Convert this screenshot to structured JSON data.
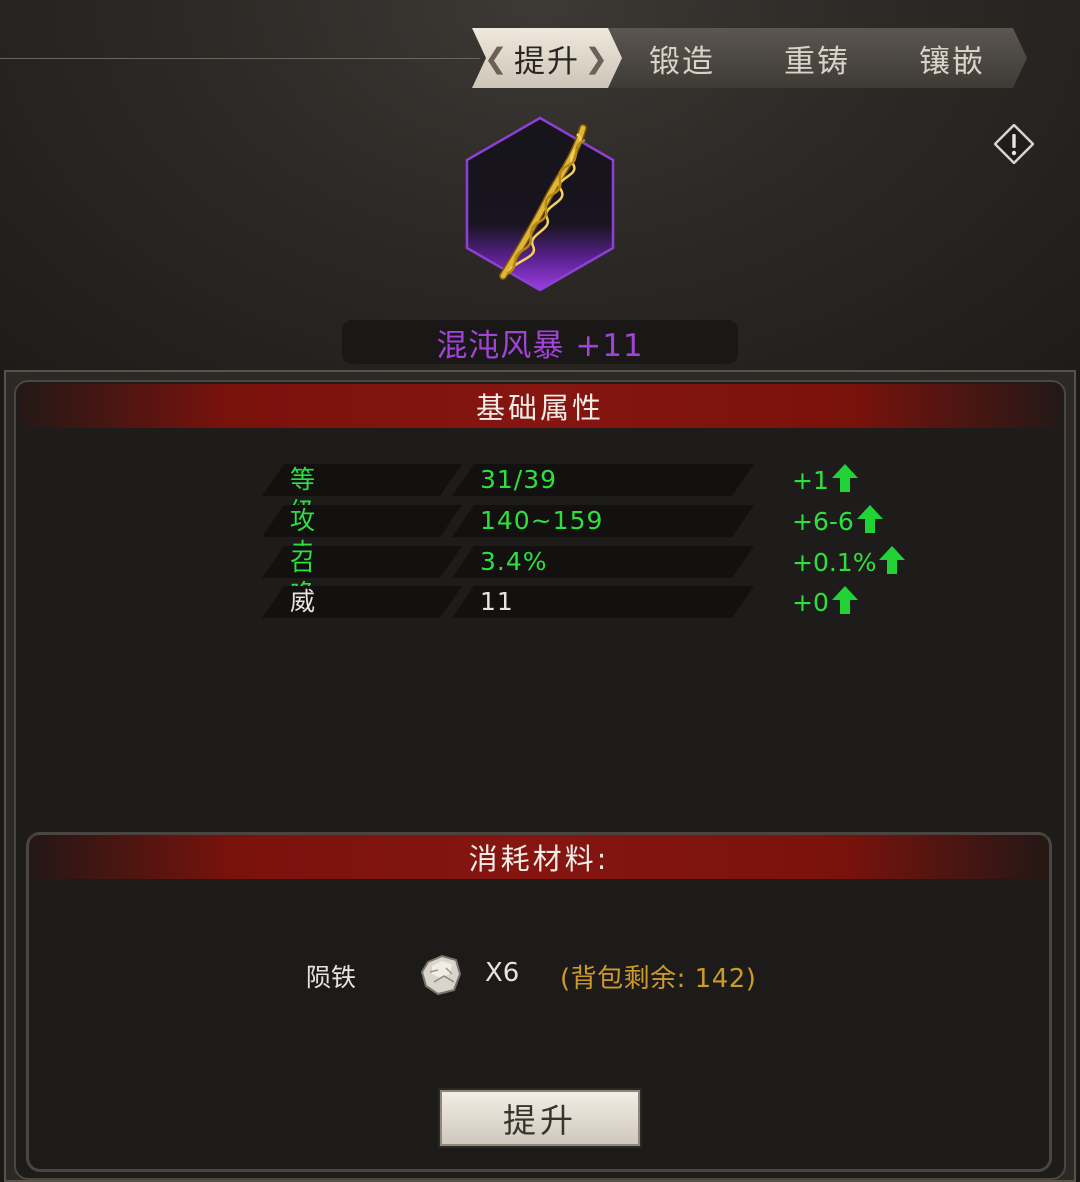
{
  "tabs": [
    {
      "label": "提升",
      "active": true
    },
    {
      "label": "锻造",
      "active": false
    },
    {
      "label": "重铸",
      "active": false
    },
    {
      "label": "镶嵌",
      "active": false
    }
  ],
  "item": {
    "name": "混沌风暴 +11",
    "icon": "golden-twisted-whip-icon",
    "rarity_color": "#a044d8"
  },
  "info_icon": "warning-diamond-icon",
  "base_attributes": {
    "title": "基础属性",
    "rows": [
      {
        "label": "等级",
        "value": "31/39",
        "delta": "+1",
        "color": "#2ee03e"
      },
      {
        "label": "攻击",
        "value": "140~159",
        "delta": "+6-6",
        "color": "#2ee03e"
      },
      {
        "label": "召唤",
        "value": "3.4%",
        "delta": "+0.1%",
        "color": "#2ee03e"
      },
      {
        "label": "威",
        "value": "11",
        "delta": "+0",
        "color": "#e8e4de"
      }
    ]
  },
  "materials": {
    "title": "消耗材料:",
    "name": "陨铁",
    "icon": "meteor-iron-ore-icon",
    "count": "X6",
    "remaining": "(背包剩余: 142)"
  },
  "upgrade_button": {
    "label": "提升"
  },
  "colors": {
    "accent_red": "#861510",
    "stat_green": "#2ee03e",
    "remaining_gold": "#cc9a2a",
    "rarity_purple": "#a044d8"
  }
}
